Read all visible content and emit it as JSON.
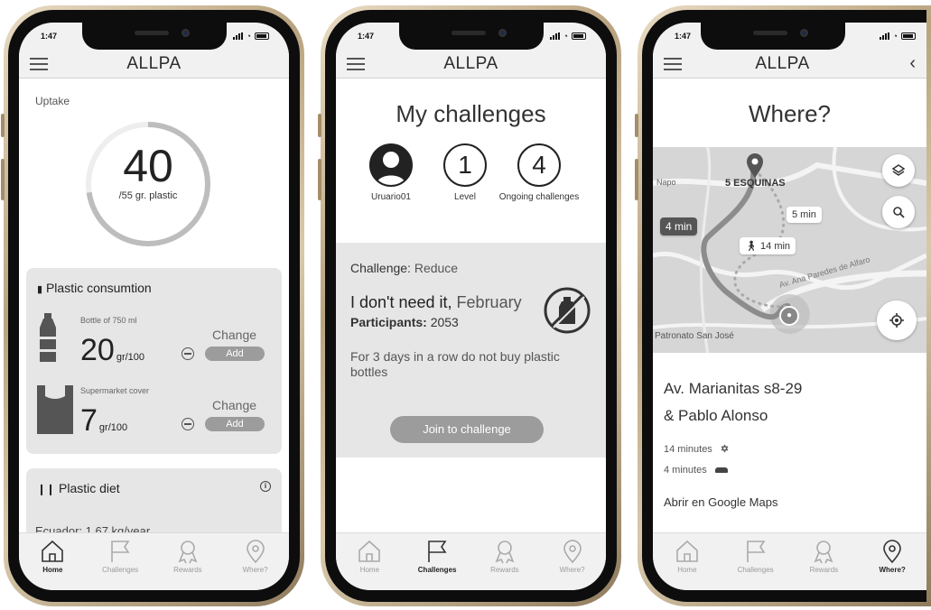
{
  "status_time": "1:47",
  "app_title": "ALLPA",
  "tabs": {
    "home": "Home",
    "challenges": "Challenges",
    "rewards": "Rewards",
    "where": "Where?"
  },
  "screen1": {
    "uptake_label": "Uptake",
    "uptake_value": "40",
    "uptake_sub": "/55 gr. plastic",
    "uptake_progress": 0.727,
    "consumption_title": "Plastic consumtion",
    "items": [
      {
        "label": "Bottle of 750 ml",
        "value": "20",
        "unit": "gr/100",
        "change": "Change",
        "add": "Add"
      },
      {
        "label": "Supermarket cover",
        "value": "7",
        "unit": "gr/100",
        "change": "Change",
        "add": "Add"
      }
    ],
    "diet_title": "Plastic diet",
    "diet_text": "Ecuador: 1,67 kg/year"
  },
  "screen2": {
    "title": "My challenges",
    "user": "Uruario01",
    "level_value": "1",
    "level_label": "Level",
    "ongoing_value": "4",
    "ongoing_label": "Ongoing challenges",
    "challenge_label": "Challenge:",
    "challenge_type": "Reduce",
    "challenge_name": "I don't need it,",
    "challenge_month": "February",
    "participants_label": "Participants:",
    "participants_value": "2053",
    "description": "For 3 days in a row do not buy plastic bottles",
    "join_label": "Join to challenge"
  },
  "screen3": {
    "title": "Where?",
    "map_labels": {
      "napo": "Napo",
      "esquinas": "5 ESQUINAS",
      "patronato": "Patronato San José",
      "street": "Av. Ana Paredes de Alfaro"
    },
    "time_car_pill": "4 min",
    "time_5_pill": "5 min",
    "time_walk_pill": "14 min",
    "address_line1": "Av. Marianitas s8-29",
    "address_line2": "& Pablo Alonso",
    "walk_time": "14 minutes",
    "car_time": "4 minutes",
    "maps_link": "Abrir en Google Maps"
  }
}
